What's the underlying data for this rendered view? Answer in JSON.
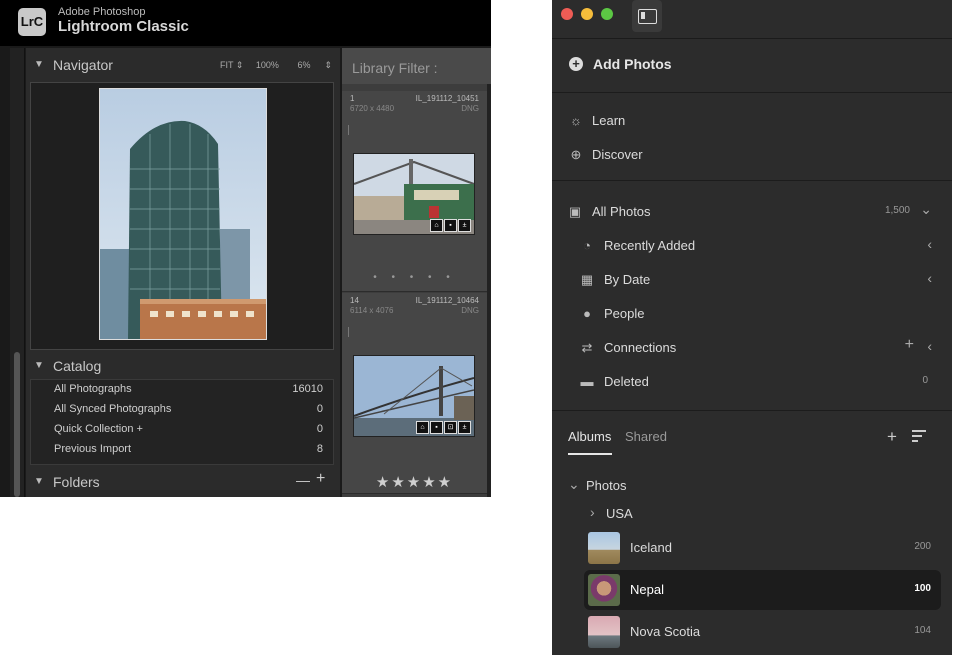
{
  "lrc": {
    "vendor": "Adobe Photoshop",
    "app_name": "Lightroom Classic",
    "logo": "LrC",
    "navigator": {
      "title": "Navigator",
      "options": [
        "FIT",
        "100%",
        "6%"
      ]
    },
    "catalog": {
      "title": "Catalog",
      "items": [
        {
          "label": "All Photographs",
          "count": "16010"
        },
        {
          "label": "All Synced Photographs",
          "count": "0"
        },
        {
          "label": "Quick Collection  +",
          "count": "0"
        },
        {
          "label": "Previous Import",
          "count": "8"
        }
      ]
    },
    "folders": {
      "title": "Folders",
      "minus": "—",
      "plus": "+"
    },
    "library_filter": "Library Filter :",
    "grid": [
      {
        "index": "1",
        "filename": "IL_191112_10451",
        "dims": "6720 x 4480",
        "format": "DNG",
        "dots": "• • • • •"
      },
      {
        "index": "14",
        "filename": "IL_191112_10464",
        "dims": "6114 x 4076",
        "format": "DNG",
        "stars": "★★★★★"
      }
    ]
  },
  "lr": {
    "add_photos": "Add Photos",
    "learn": "Learn",
    "discover": "Discover",
    "all_photos": {
      "label": "All Photos",
      "count": "1,500"
    },
    "nav": [
      {
        "label": "Recently Added",
        "icon": "clock-icon"
      },
      {
        "label": "By Date",
        "icon": "calendar-icon"
      },
      {
        "label": "People",
        "icon": "person-icon"
      },
      {
        "label": "Connections",
        "icon": "connections-icon"
      },
      {
        "label": "Deleted",
        "icon": "trash-icon",
        "count": "0"
      }
    ],
    "tabs": {
      "albums": "Albums",
      "shared": "Shared"
    },
    "folder": "Photos",
    "subfolder": "USA",
    "albums": [
      {
        "label": "Iceland",
        "count": "200"
      },
      {
        "label": "Nepal",
        "count": "100",
        "selected": true
      },
      {
        "label": "Nova Scotia",
        "count": "104"
      }
    ]
  }
}
